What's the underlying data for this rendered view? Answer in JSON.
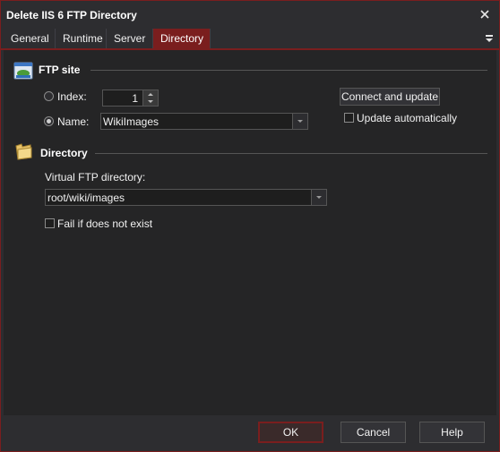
{
  "window": {
    "title": "Delete IIS 6 FTP Directory"
  },
  "tabs": [
    {
      "label": "General"
    },
    {
      "label": "Runtime"
    },
    {
      "label": "Server"
    },
    {
      "label": "Directory",
      "active": true
    }
  ],
  "ftp_site": {
    "heading": "FTP site",
    "index_label": "Index:",
    "index_value": "1",
    "name_label": "Name:",
    "name_value": "WikiImages",
    "selected_option": "Name",
    "connect_button": "Connect and update",
    "update_auto_label": "Update automatically",
    "update_auto_checked": false
  },
  "directory": {
    "heading": "Directory",
    "virtual_label": "Virtual FTP directory:",
    "virtual_value": "root/wiki/images",
    "fail_label": "Fail if does not exist",
    "fail_checked": false
  },
  "footer": {
    "ok": "OK",
    "cancel": "Cancel",
    "help": "Help"
  },
  "colors": {
    "accent": "#7a1e1e",
    "background": "#2d2d30",
    "panel": "#252526"
  },
  "icons": [
    "close-icon",
    "tab-menu-icon",
    "ftp-site-icon",
    "folder-icon",
    "chevron-down-icon",
    "spin-up-icon",
    "spin-down-icon"
  ]
}
